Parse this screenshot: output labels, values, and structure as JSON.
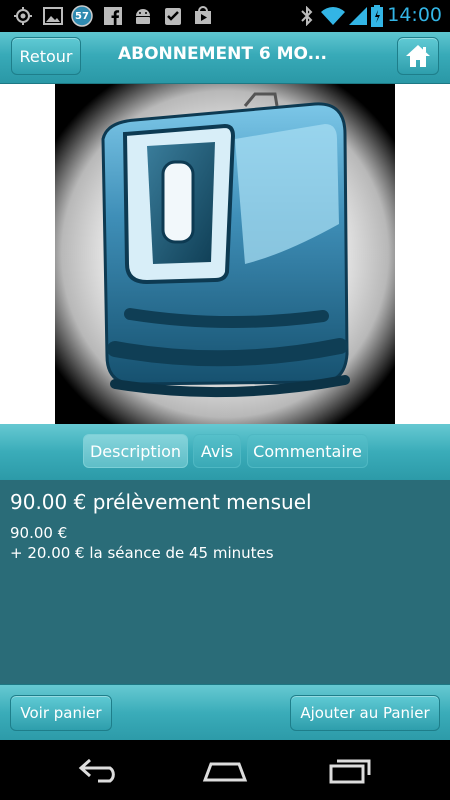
{
  "status_bar": {
    "time": "14:00",
    "notification_badge": "57",
    "icons": [
      "gps-icon",
      "image-icon",
      "notification-badge-icon",
      "facebook-icon",
      "android-icon",
      "checklist-icon",
      "play-store-icon",
      "bluetooth-icon",
      "wifi-icon",
      "signal-icon",
      "battery-icon"
    ]
  },
  "header": {
    "back_label": "Retour",
    "title": "ABONNEMENT 6 MO...",
    "home_icon": "home-icon"
  },
  "tabs": [
    {
      "label": "Description",
      "active": true
    },
    {
      "label": "Avis",
      "active": false
    },
    {
      "label": "Commentaire",
      "active": false
    }
  ],
  "content": {
    "title": "90.00 € prélèvement mensuel",
    "line1": "90.00 €",
    "line2": "+ 20.00 € la séance de 45 minutes"
  },
  "bottom": {
    "cart_label": "Voir panier",
    "add_label": "Ajouter au Panier"
  },
  "nav": {
    "icons": [
      "back-nav-icon",
      "home-nav-icon",
      "recent-apps-icon"
    ]
  },
  "colors": {
    "accent": "#33b5e5",
    "header": "#38aab8",
    "content_bg": "#2a6c78"
  }
}
